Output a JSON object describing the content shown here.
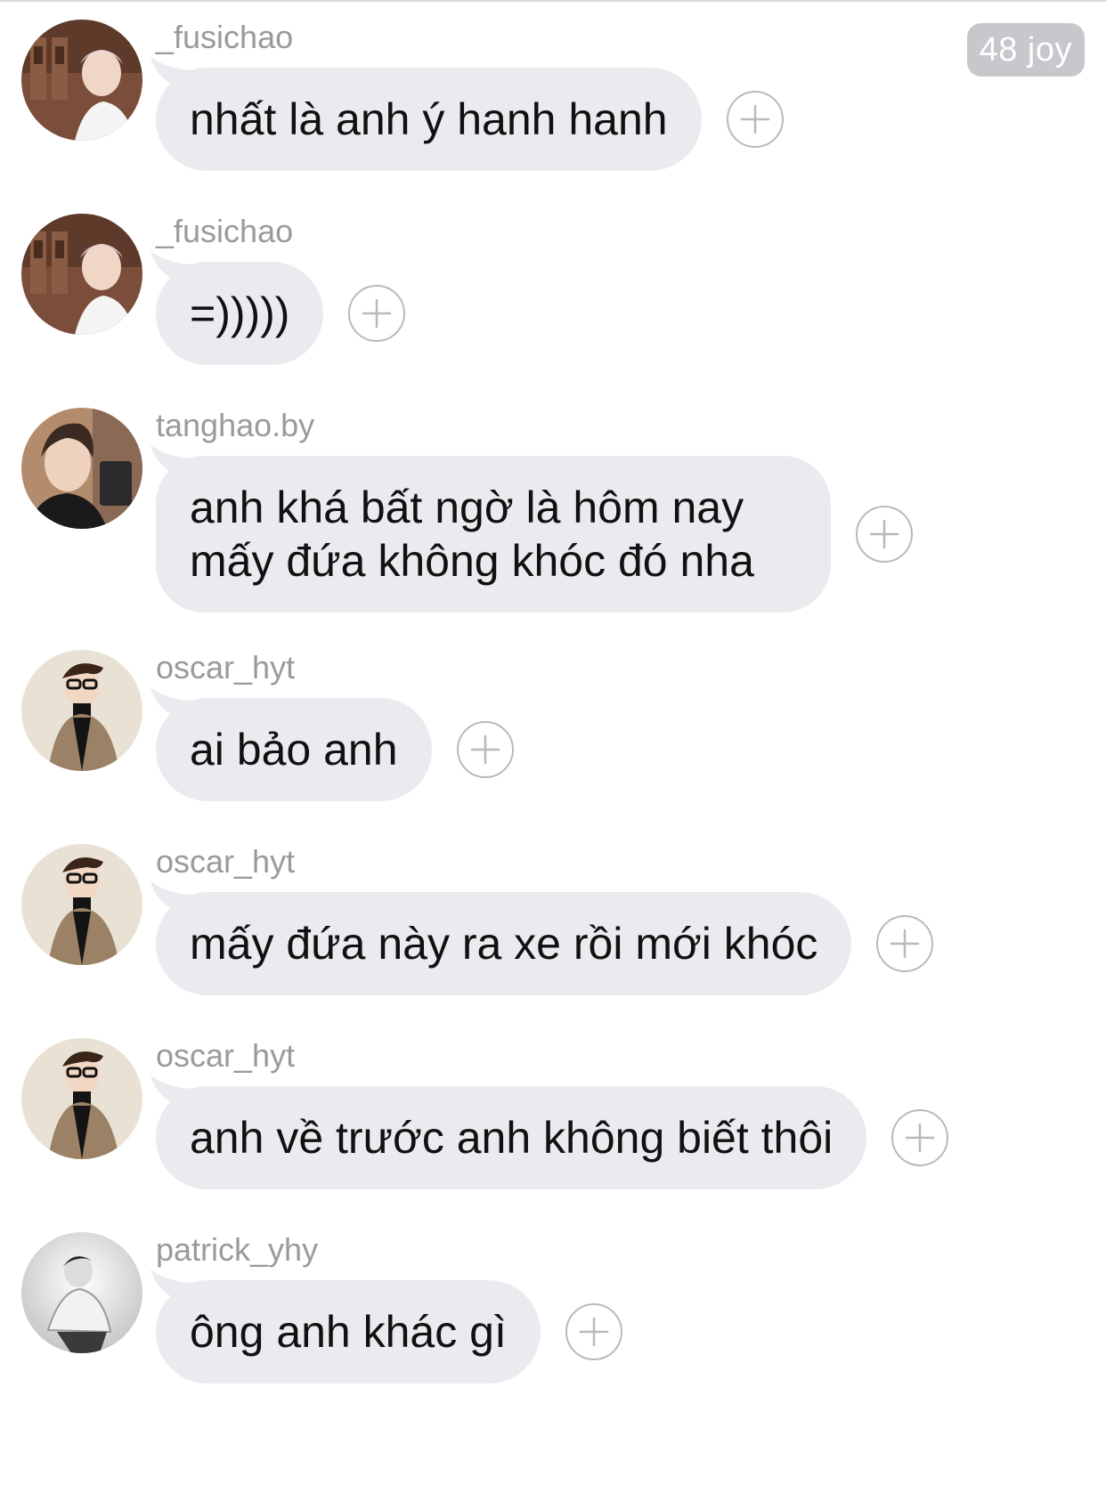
{
  "reaction_badge": "48 joy",
  "messages": [
    {
      "username": "_fusichao",
      "text": "nhất là anh ý hanh hanh",
      "avatar": "avatar-fusichao"
    },
    {
      "username": "_fusichao",
      "text": "=)))))",
      "avatar": "avatar-fusichao"
    },
    {
      "username": "tanghao.by",
      "text": "anh khá bất ngờ là hôm nay mấy đứa không khóc đó nha",
      "avatar": "avatar-tanghao"
    },
    {
      "username": "oscar_hyt",
      "text": "ai bảo anh",
      "avatar": "avatar-oscar"
    },
    {
      "username": "oscar_hyt",
      "text": "mấy đứa này ra xe rồi mới khóc",
      "avatar": "avatar-oscar"
    },
    {
      "username": "oscar_hyt",
      "text": "anh về trước anh không biết thôi",
      "avatar": "avatar-oscar"
    },
    {
      "username": "patrick_yhy",
      "text": "ông anh khác gì",
      "avatar": "avatar-patrick"
    }
  ],
  "icons": {
    "add_reaction": "plus-circle-icon"
  },
  "colors": {
    "bubble": "#e9ebef",
    "username": "#9a9a9a",
    "badge": "#c7c7cc"
  }
}
